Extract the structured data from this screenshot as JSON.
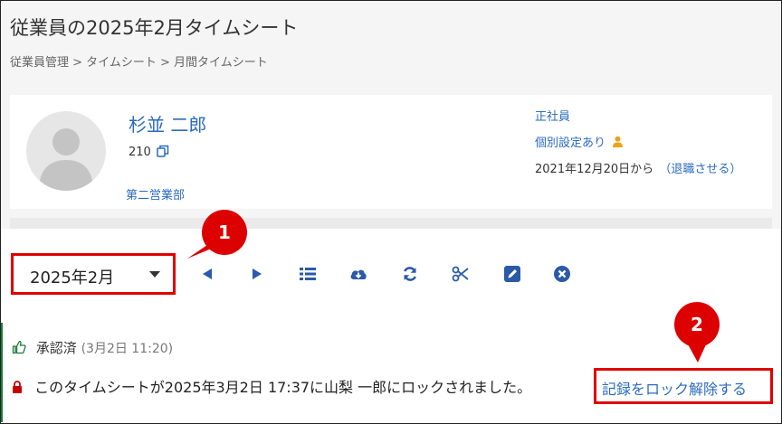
{
  "page": {
    "title": "従業員の2025年2月タイムシート",
    "breadcrumb": "従業員管理 > タイムシート > 月間タイムシート"
  },
  "employee": {
    "name": "杉並 二郎",
    "id": "210",
    "department": "第二営業部",
    "employment_type": "正社員",
    "custom_settings": "個別設定あり",
    "start_date": "2021年12月20日から",
    "retire_link": "（退職させる）"
  },
  "toolbar": {
    "month_value": "2025年2月",
    "icons": [
      "prev-month-icon",
      "next-month-icon",
      "list-icon",
      "cloud-download-icon",
      "refresh-icon",
      "scissors-icon",
      "edit-icon",
      "close-circle-icon"
    ]
  },
  "status": {
    "approved_label": "承認済",
    "approved_time": "(3月2日 11:20)",
    "lock_message": "このタイムシートが2025年3月2日 17:37に山梨 一郎にロックされました。",
    "unlock_link": "記録をロック解除する"
  },
  "annotations": {
    "badge1": "1",
    "badge2": "2"
  },
  "colors": {
    "link": "#2a6bbf",
    "icon": "#2a5aa8",
    "highlight": "#e00000",
    "approved": "#1a7a3a",
    "lock": "#c40000"
  }
}
